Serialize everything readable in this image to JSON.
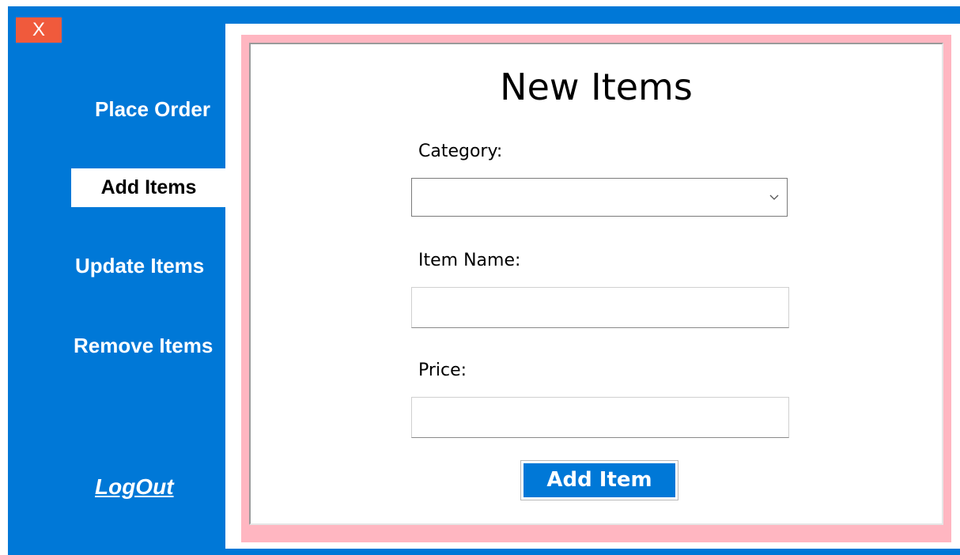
{
  "window": {
    "close_label": "X"
  },
  "sidebar": {
    "items": [
      {
        "label": "Place Order"
      },
      {
        "label": "Add Items",
        "active": true
      },
      {
        "label": "Update Items"
      },
      {
        "label": "Remove Items"
      }
    ],
    "logout_label": "LogOut"
  },
  "form": {
    "title": "New Items",
    "category": {
      "label": "Category:",
      "value": ""
    },
    "item_name": {
      "label": "Item Name:",
      "value": ""
    },
    "price": {
      "label": "Price:",
      "value": ""
    },
    "submit_label": "Add Item"
  },
  "colors": {
    "sidebar_bg": "#0078D7",
    "close_button": "#F05A3C",
    "frame_border": "#FFB6C1",
    "button_bg": "#0078D7"
  },
  "icons": {
    "dropdown": "chevron-down-icon"
  }
}
